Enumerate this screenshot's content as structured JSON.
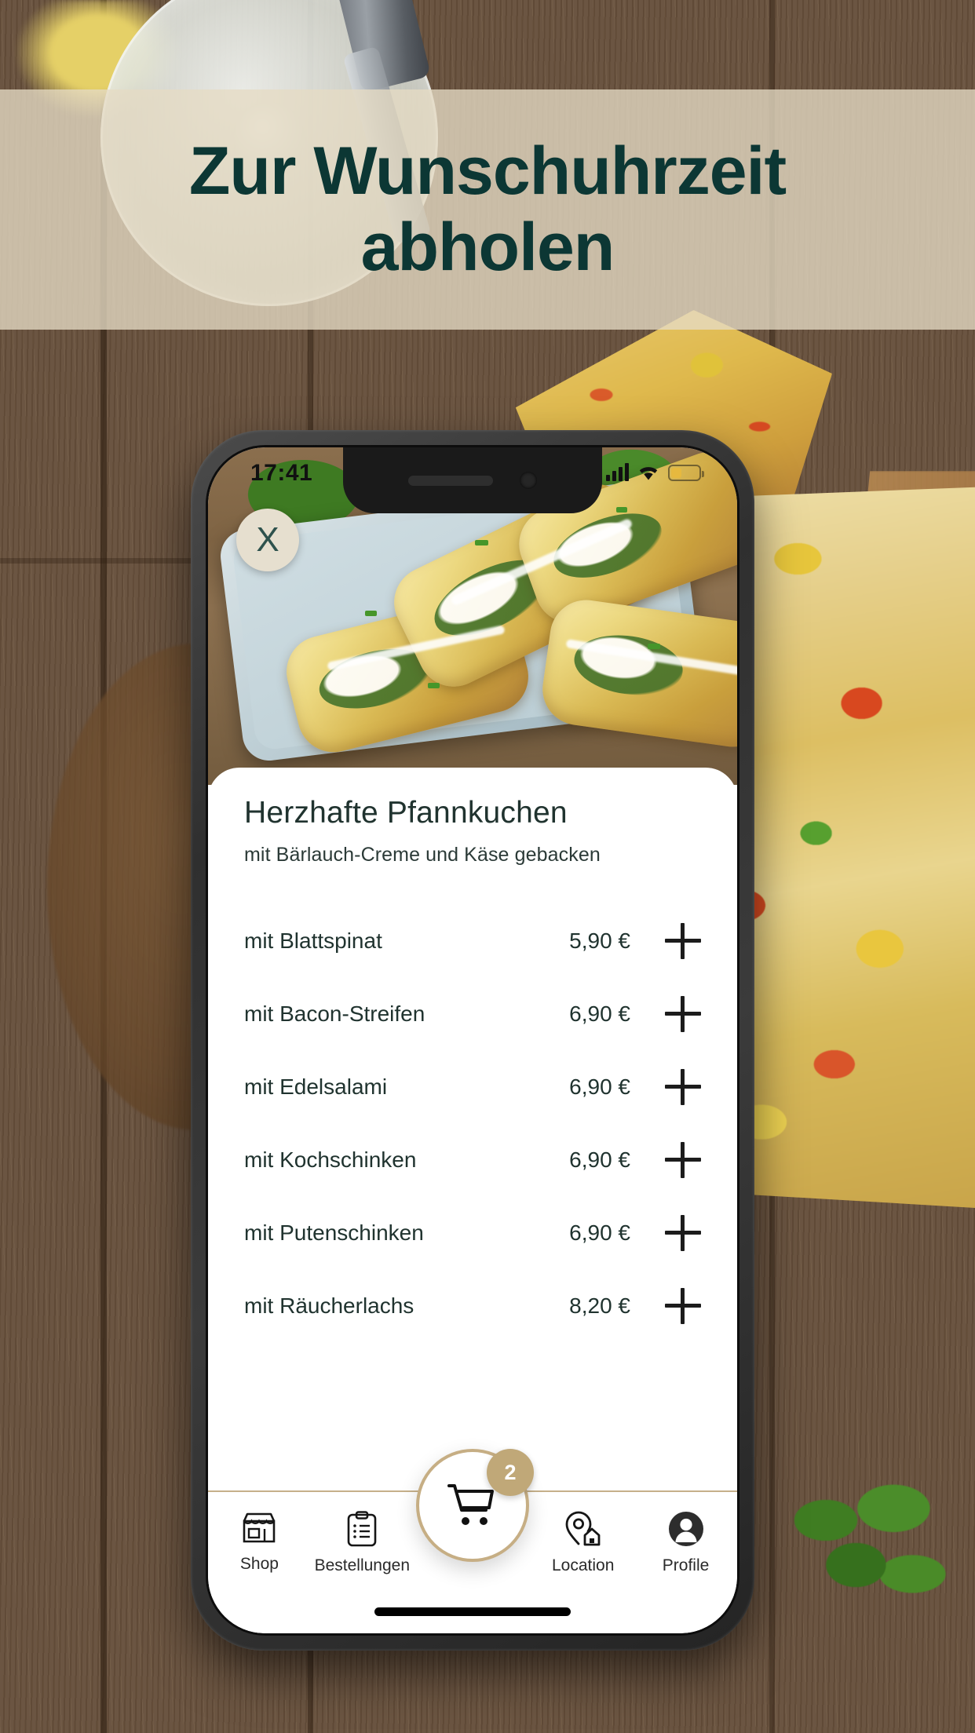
{
  "promo": {
    "headline_line1": "Zur Wunschuhrzeit",
    "headline_line2": "abholen",
    "headline_color": "#0c3734",
    "banner_bg": "#e5dbc4"
  },
  "phone": {
    "status_bar": {
      "time": "17:41",
      "signal_icon": "cellular-bars-icon",
      "wifi_icon": "wifi-icon",
      "battery_icon": "battery-low-icon",
      "battery_color": "#e6b93f"
    },
    "close_button": {
      "label": "X",
      "icon": "close-x-icon"
    },
    "detail": {
      "title": "Herzhafte Pfannkuchen",
      "subtitle": "mit Bärlauch-Creme und Käse gebacken",
      "options": [
        {
          "name": "mit Blattspinat",
          "price": "5,90 €",
          "add_icon": "plus-icon"
        },
        {
          "name": "mit Bacon-Streifen",
          "price": "6,90 €",
          "add_icon": "plus-icon"
        },
        {
          "name": "mit Edelsalami",
          "price": "6,90 €",
          "add_icon": "plus-icon"
        },
        {
          "name": "mit Kochschinken",
          "price": "6,90 €",
          "add_icon": "plus-icon"
        },
        {
          "name": "mit Putenschinken",
          "price": "6,90 €",
          "add_icon": "plus-icon"
        },
        {
          "name": "mit Räucherlachs",
          "price": "8,20 €",
          "add_icon": "plus-icon"
        }
      ]
    },
    "navbar": {
      "accent_color": "#c6ae84",
      "items": [
        {
          "label": "Shop",
          "icon": "storefront-icon"
        },
        {
          "label": "Bestellungen",
          "icon": "clipboard-list-icon"
        },
        {
          "label": "Location",
          "icon": "map-pin-home-icon"
        },
        {
          "label": "Profile",
          "icon": "user-avatar-icon"
        }
      ],
      "cart": {
        "icon": "shopping-cart-icon",
        "badge": "2",
        "badge_color": "#c0a878"
      }
    }
  }
}
